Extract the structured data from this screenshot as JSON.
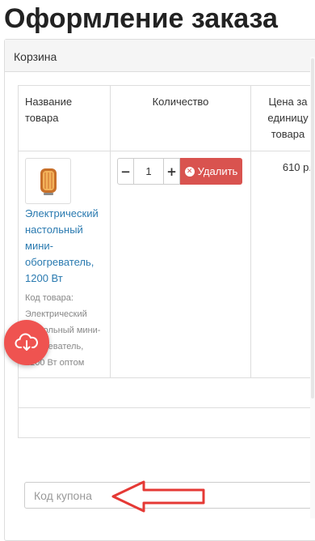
{
  "page": {
    "title": "Оформление заказа"
  },
  "cart": {
    "heading": "Корзина",
    "columns": {
      "name": "Название товара",
      "quantity": "Количество",
      "price": "Цена за единицу товара"
    },
    "items": [
      {
        "name": "Электрический настольный мини-обогреватель, 1200 Вт",
        "code_text": "Код товара: Электрический настольный мини-обогреватель, 1200 Вт оптом",
        "quantity": "1",
        "delete_label": "Удалить",
        "price": "610 р."
      }
    ],
    "qty_minus": "−",
    "qty_plus": "+"
  },
  "coupon": {
    "placeholder": "Код купона",
    "value": ""
  },
  "icons": {
    "upload": "cloud-download-icon",
    "delete": "x-circle-icon",
    "annotation": "red-arrow-left"
  },
  "colors": {
    "link": "#2a7ab0",
    "danger": "#d9534f",
    "fab": "#ef5350",
    "annotation": "#e53935"
  }
}
